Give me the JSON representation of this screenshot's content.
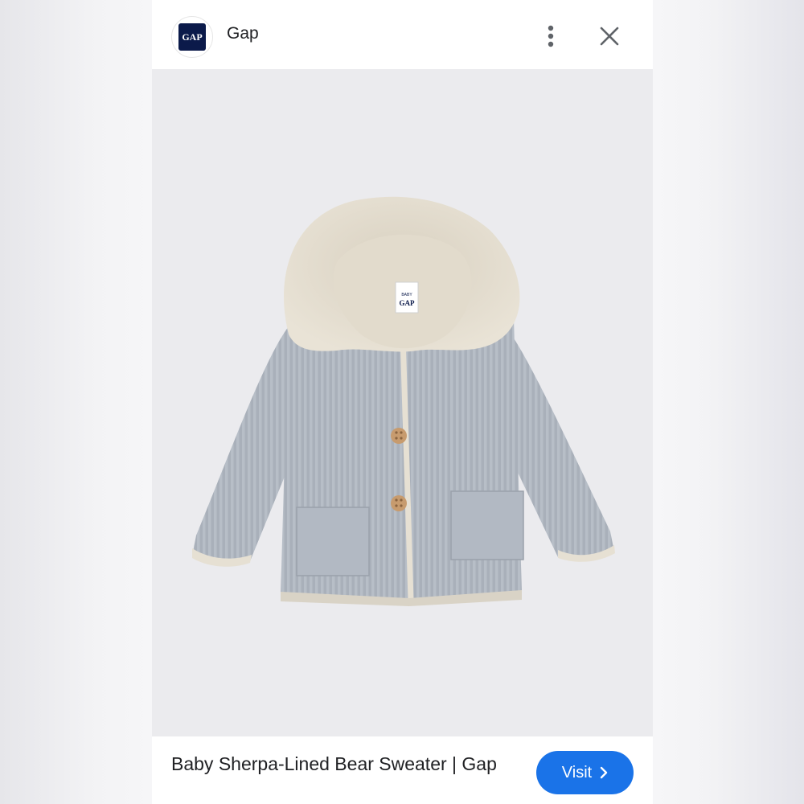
{
  "header": {
    "logo_text": "GAP",
    "site_name": "Gap",
    "more_icon": "more-vert-icon",
    "close_icon": "close-icon"
  },
  "image": {
    "description_icon": "product-image",
    "tag_text_top": "BABY",
    "tag_text_bottom": "GAP"
  },
  "footer": {
    "title": "Baby Sherpa-Lined Bear Sweater | Gap",
    "visit_label": "Visit",
    "visit_icon": "chevron-right-icon"
  },
  "colors": {
    "accent": "#1a73e8",
    "logo_bg": "#0b1a4a",
    "image_bg": "#ebebee"
  }
}
